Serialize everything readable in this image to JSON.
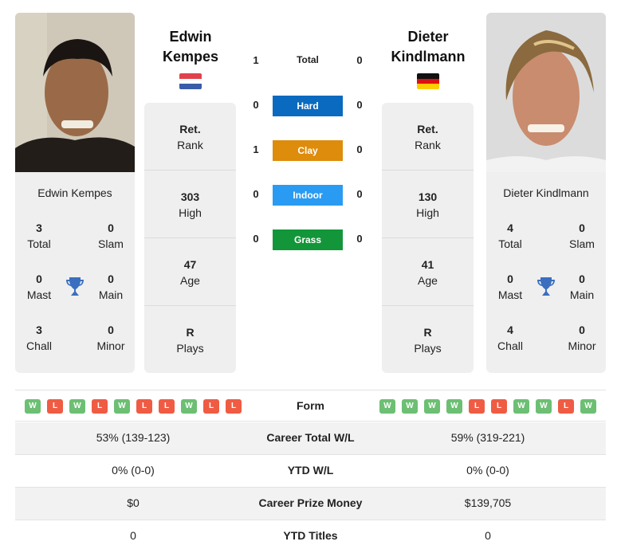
{
  "player1": {
    "name": "Edwin Kempes",
    "name_line1": "Edwin",
    "name_line2": "Kempes",
    "country_flag": "netherlands-flag",
    "flag_colors": [
      "#ae1c28",
      "#ffffff",
      "#21468b"
    ],
    "titles": {
      "total": {
        "value": "3",
        "label": "Total"
      },
      "slam": {
        "value": "0",
        "label": "Slam"
      },
      "mast": {
        "value": "0",
        "label": "Mast"
      },
      "main": {
        "value": "0",
        "label": "Main"
      },
      "chall": {
        "value": "3",
        "label": "Chall"
      },
      "minor": {
        "value": "0",
        "label": "Minor"
      }
    },
    "info": {
      "rank": {
        "value": "Ret.",
        "label": "Rank"
      },
      "high": {
        "value": "303",
        "label": "High"
      },
      "age": {
        "value": "47",
        "label": "Age"
      },
      "plays": {
        "value": "R",
        "label": "Plays"
      }
    },
    "form": [
      "W",
      "L",
      "W",
      "L",
      "W",
      "L",
      "L",
      "W",
      "L",
      "L"
    ]
  },
  "player2": {
    "name": "Dieter Kindlmann",
    "name_line1": "Dieter",
    "name_line2": "Kindlmann",
    "country_flag": "germany-flag",
    "flag_colors": [
      "#000000",
      "#dd0000",
      "#ffce00"
    ],
    "titles": {
      "total": {
        "value": "4",
        "label": "Total"
      },
      "slam": {
        "value": "0",
        "label": "Slam"
      },
      "mast": {
        "value": "0",
        "label": "Mast"
      },
      "main": {
        "value": "0",
        "label": "Main"
      },
      "chall": {
        "value": "4",
        "label": "Chall"
      },
      "minor": {
        "value": "0",
        "label": "Minor"
      }
    },
    "info": {
      "rank": {
        "value": "Ret.",
        "label": "Rank"
      },
      "high": {
        "value": "130",
        "label": "High"
      },
      "age": {
        "value": "41",
        "label": "Age"
      },
      "plays": {
        "value": "R",
        "label": "Plays"
      }
    },
    "form": [
      "W",
      "W",
      "W",
      "W",
      "L",
      "L",
      "W",
      "W",
      "L",
      "W"
    ]
  },
  "h2h": {
    "total": {
      "label": "Total",
      "p1": "1",
      "p2": "0"
    },
    "surfaces": [
      {
        "label": "Hard",
        "p1": "0",
        "p2": "0",
        "color": "#0a6ac0"
      },
      {
        "label": "Clay",
        "p1": "1",
        "p2": "0",
        "color": "#de8c0c"
      },
      {
        "label": "Indoor",
        "p1": "0",
        "p2": "0",
        "color": "#2a9bf3"
      },
      {
        "label": "Grass",
        "p1": "0",
        "p2": "0",
        "color": "#139639"
      }
    ]
  },
  "form_label": "Form",
  "comparison": [
    {
      "label": "Career Total W/L",
      "p1": "53% (139-123)",
      "p2": "59% (319-221)"
    },
    {
      "label": "YTD W/L",
      "p1": "0% (0-0)",
      "p2": "0% (0-0)"
    },
    {
      "label": "Career Prize Money",
      "p1": "$0",
      "p2": "$139,705"
    },
    {
      "label": "YTD Titles",
      "p1": "0",
      "p2": "0"
    }
  ],
  "colors": {
    "win": "#6cbf73",
    "loss": "#ef5c43",
    "trophy": "#3a6fc0"
  }
}
